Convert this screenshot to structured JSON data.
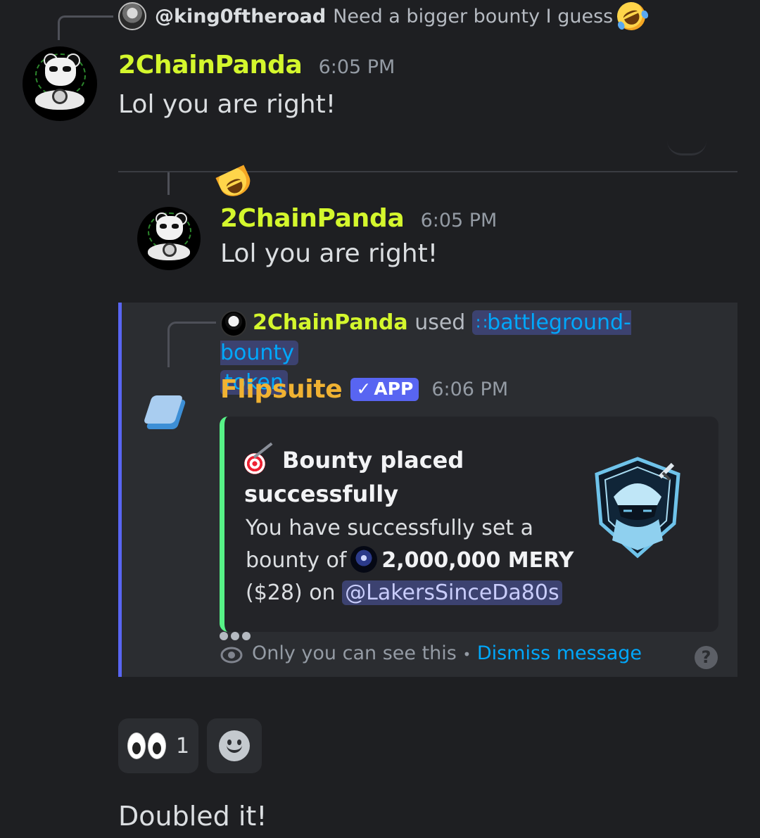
{
  "reply_ref": {
    "username": "@king0ftheroad",
    "text": "Need a bigger bounty I guess",
    "emoji": "rolling-on-floor-laughing-emoji"
  },
  "message1": {
    "username": "2ChainPanda",
    "timestamp": "6:05 PM",
    "text": "Lol you are right!"
  },
  "quoted": {
    "username": "2ChainPanda",
    "timestamp": "6:05 PM",
    "text": "Lol you are right!",
    "emoji": "rolling-on-floor-laughing-emoji"
  },
  "interaction": {
    "username": "2ChainPanda",
    "used_label": "used",
    "command_glyph": "∷",
    "command_part1": "battleground-bounty",
    "command_part2": "token"
  },
  "bot_message": {
    "username": "Flipsuite",
    "badge_check": "✓",
    "badge": "APP",
    "timestamp": "6:06 PM",
    "embed": {
      "title_icon": "dart-bullseye-emoji",
      "title_line1": "Bounty placed",
      "title_line2": "successfully",
      "desc_line1": "You have successfully set a",
      "desc_bounty_of": "bounty of",
      "amount": "2,000,000 MERY",
      "price": "($28) on",
      "mention": "@LakersSinceDa80s",
      "accent_color": "#57f287"
    },
    "ephemeral_note": "Only you can see this",
    "separator": "•",
    "dismiss_label": "Dismiss message",
    "help_glyph": "?"
  },
  "reactions": [
    {
      "emoji": "eyes-emoji",
      "count": "1"
    },
    {
      "emoji": "add-reaction-icon",
      "count": ""
    }
  ],
  "message2": {
    "text": "Doubled it!"
  },
  "colors": {
    "background": "#1e1f22",
    "username_panda": "#d4f72d",
    "username_bot": "#f0b232",
    "link": "#00a8fc",
    "blurple": "#5865f2"
  }
}
